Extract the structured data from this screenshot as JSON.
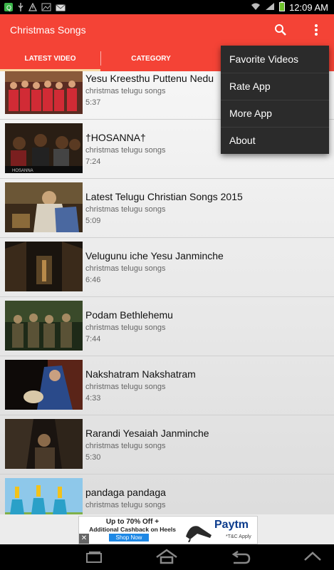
{
  "status": {
    "time": "12:09 AM"
  },
  "app": {
    "title": "Christmas Songs"
  },
  "tabs": [
    "LATEST VIDEO",
    "CATEGORY"
  ],
  "videos": [
    {
      "title": "Yesu Kreesthu Puttenu Nedu",
      "category": "christmas telugu songs",
      "duration": "5:37"
    },
    {
      "title": "†HOSANNA†",
      "category": "christmas telugu songs",
      "duration": "7:24"
    },
    {
      "title": "Latest Telugu Christian Songs 2015",
      "category": "christmas telugu songs",
      "duration": "5:09"
    },
    {
      "title": "Velugunu iche Yesu Janminche",
      "category": "christmas telugu songs",
      "duration": "6:46"
    },
    {
      "title": "Podam Bethlehemu",
      "category": "christmas telugu songs",
      "duration": "7:44"
    },
    {
      "title": "Nakshatram Nakshatram",
      "category": "christmas telugu songs",
      "duration": "4:33"
    },
    {
      "title": "Rarandi Yesaiah Janminche",
      "category": "christmas telugu songs",
      "duration": "5:30"
    },
    {
      "title": "pandaga pandaga",
      "category": "christmas telugu songs",
      "duration": ""
    }
  ],
  "menu": [
    "Favorite Videos",
    "Rate App",
    "More App",
    "About"
  ],
  "ad": {
    "line1": "Up to 70% Off +",
    "line2": "Additional Cashback on Heels",
    "cta": "Shop Now",
    "brand": "Paytm",
    "tc": "*T&C Apply"
  },
  "colors": {
    "primary": "#f44336",
    "indicator": "#f8d6a0",
    "menu_bg": "#2b2b2b"
  }
}
